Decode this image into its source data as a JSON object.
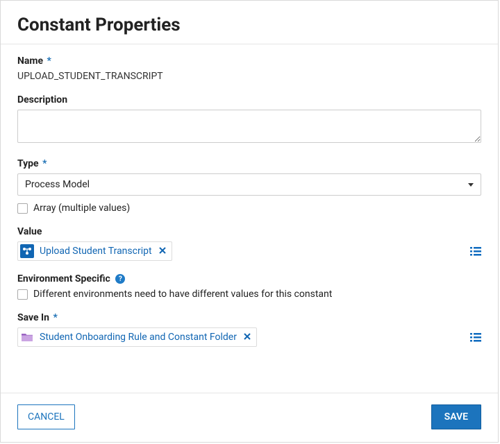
{
  "dialog": {
    "title": "Constant Properties"
  },
  "labels": {
    "name": "Name",
    "description": "Description",
    "type": "Type",
    "array": "Array (multiple values)",
    "value": "Value",
    "env_specific": "Environment Specific",
    "env_specific_hint": "Different environments need to have different values for this constant",
    "save_in": "Save In",
    "required_mark": "*"
  },
  "values": {
    "name": "UPLOAD_STUDENT_TRANSCRIPT",
    "description": "",
    "type": "Process Model",
    "array_checked": false,
    "value_chip": "Upload Student Transcript",
    "env_checked": false,
    "save_in_chip": "Student Onboarding Rule and Constant Folder"
  },
  "buttons": {
    "cancel": "CANCEL",
    "save": "SAVE"
  },
  "icons": {
    "help": "?"
  }
}
